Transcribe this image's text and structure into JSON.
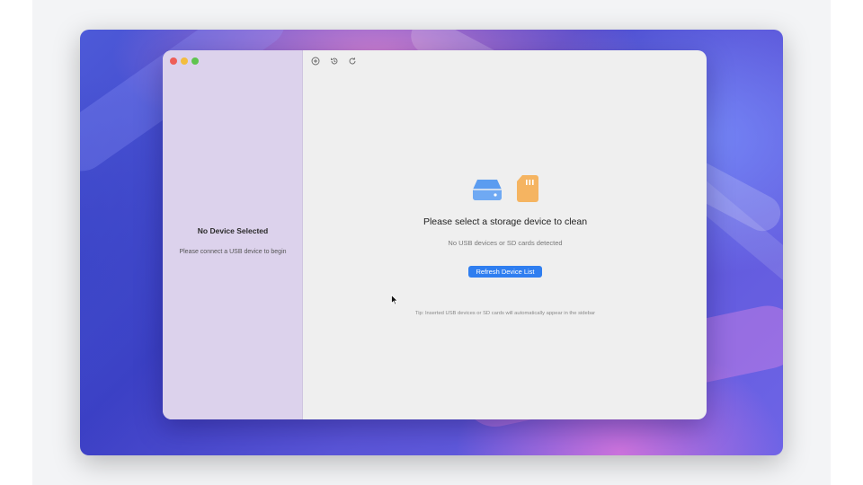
{
  "sidebar": {
    "title": "No Device Selected",
    "subtitle": "Please connect a USB device to begin"
  },
  "toolbar": {
    "icons": [
      "add-circle-icon",
      "history-icon",
      "refresh-icon"
    ]
  },
  "main": {
    "heading": "Please select a storage device to clean",
    "subheading": "No USB devices or SD cards detected",
    "refresh_label": "Refresh Device List",
    "tip": "Tip: Inserted USB devices or SD cards will automatically appear in the sidebar"
  },
  "colors": {
    "accent": "#2f7ef0",
    "drive_icon": "#5b9cf0",
    "sd_icon": "#f5b461",
    "sidebar_bg": "#dcd2ec"
  }
}
